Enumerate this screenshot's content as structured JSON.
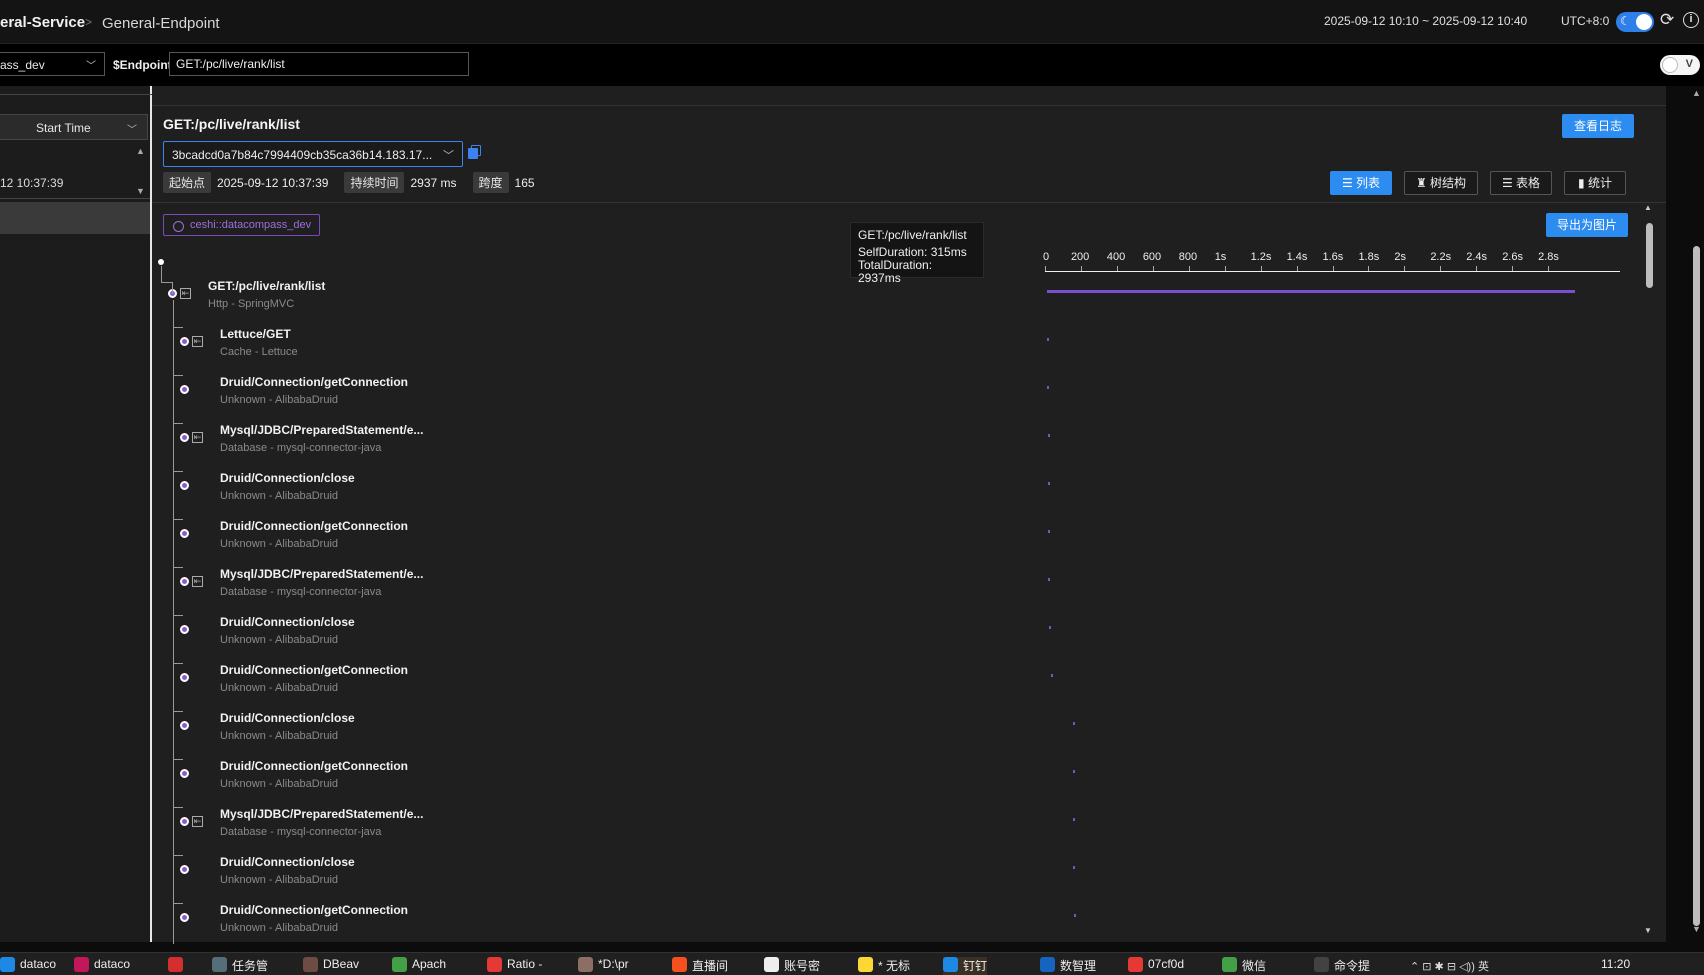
{
  "header": {
    "service": "eral-Service",
    "separator": ">",
    "endpoint": "General-Endpoint",
    "time_range": "2025-09-12 10:10 ~ 2025-09-12 10:40",
    "timezone": "UTC+8:0"
  },
  "filters": {
    "service_value": "ass_dev",
    "endpoint_label": "$Endpoint",
    "endpoint_value": "GET:/pc/live/rank/list",
    "v_toggle_label": "V"
  },
  "left_panel": {
    "sort_label": "Start Time",
    "trace_time": "12 10:37:39"
  },
  "trace": {
    "title": "GET:/pc/live/rank/list",
    "view_log": "查看日志",
    "trace_id": "3bcadcd0a7b84c7994409cb35ca36b14.183.17...",
    "start_label": "起始点",
    "start_value": "2025-09-12 10:37:39",
    "duration_label": "持续时间",
    "duration_value": "2937 ms",
    "span_label": "跨度",
    "span_value": "165",
    "tabs": [
      "列表",
      "树结构",
      "表格",
      "统计"
    ],
    "service_chip": "ceshi::datacompass_dev",
    "export": "导出为图片"
  },
  "tooltip": {
    "name": "GET:/pc/live/rank/list",
    "self": "SelfDuration: 315ms",
    "total": "TotalDuration: 2937ms"
  },
  "axis_ticks": [
    "0",
    "200",
    "400",
    "600",
    "800",
    "1s",
    "1.2s",
    "1.4s",
    "1.6s",
    "1.8s",
    "2s",
    "2.2s",
    "2.4s",
    "2.6s",
    "2.8s"
  ],
  "spans": [
    {
      "name": "GET:/pc/live/rank/list",
      "sub": "Http - SpringMVC",
      "level": 0,
      "toggle": true
    },
    {
      "name": "Lettuce/GET",
      "sub": "Cache - Lettuce",
      "level": 1,
      "toggle": true
    },
    {
      "name": "Druid/Connection/getConnection",
      "sub": "Unknown - AlibabaDruid",
      "level": 1,
      "toggle": false
    },
    {
      "name": "Mysql/JDBC/PreparedStatement/e...",
      "sub": "Database - mysql-connector-java",
      "level": 1,
      "toggle": true
    },
    {
      "name": "Druid/Connection/close",
      "sub": "Unknown - AlibabaDruid",
      "level": 1,
      "toggle": false
    },
    {
      "name": "Druid/Connection/getConnection",
      "sub": "Unknown - AlibabaDruid",
      "level": 1,
      "toggle": false
    },
    {
      "name": "Mysql/JDBC/PreparedStatement/e...",
      "sub": "Database - mysql-connector-java",
      "level": 1,
      "toggle": true
    },
    {
      "name": "Druid/Connection/close",
      "sub": "Unknown - AlibabaDruid",
      "level": 1,
      "toggle": false
    },
    {
      "name": "Druid/Connection/getConnection",
      "sub": "Unknown - AlibabaDruid",
      "level": 1,
      "toggle": false
    },
    {
      "name": "Druid/Connection/close",
      "sub": "Unknown - AlibabaDruid",
      "level": 1,
      "toggle": false
    },
    {
      "name": "Druid/Connection/getConnection",
      "sub": "Unknown - AlibabaDruid",
      "level": 1,
      "toggle": false
    },
    {
      "name": "Mysql/JDBC/PreparedStatement/e...",
      "sub": "Database - mysql-connector-java",
      "level": 1,
      "toggle": true
    },
    {
      "name": "Druid/Connection/close",
      "sub": "Unknown - AlibabaDruid",
      "level": 1,
      "toggle": false
    },
    {
      "name": "Druid/Connection/getConnection",
      "sub": "Unknown - AlibabaDruid",
      "level": 1,
      "toggle": false
    }
  ],
  "span_timing_ms": [
    {
      "start": 0,
      "end": 2937
    },
    {
      "start": 0,
      "end": 8
    },
    {
      "start": 2,
      "end": 9
    },
    {
      "start": 3,
      "end": 10
    },
    {
      "start": 4,
      "end": 11
    },
    {
      "start": 6,
      "end": 13
    },
    {
      "start": 8,
      "end": 15
    },
    {
      "start": 10,
      "end": 17
    },
    {
      "start": 22,
      "end": 35
    },
    {
      "start": 142,
      "end": 149
    },
    {
      "start": 143,
      "end": 150
    },
    {
      "start": 145,
      "end": 152
    },
    {
      "start": 147,
      "end": 154
    },
    {
      "start": 149,
      "end": 156
    }
  ],
  "taskbar": {
    "items": [
      {
        "label": "dataco",
        "color": "#1e88e5"
      },
      {
        "label": "dataco",
        "color": "#c2185b"
      },
      {
        "label": "",
        "color": "#d32f2f"
      },
      {
        "label": "任务管",
        "color": "#546e7a"
      },
      {
        "label": "DBeav",
        "color": "#6d4c41"
      },
      {
        "label": "Apach",
        "color": "#43a047"
      },
      {
        "label": "Ratio -",
        "color": "#e53935"
      },
      {
        "label": "*D:\\pr",
        "color": "#8d6e63"
      },
      {
        "label": "直播间",
        "color": "#f4511e"
      },
      {
        "label": "账号密",
        "color": "#eeeeee"
      },
      {
        "label": "* 无标",
        "color": "#fdd835"
      },
      {
        "label": "钉钉",
        "color": "#1e88e5"
      },
      {
        "label": "数智理",
        "color": "#1565c0"
      },
      {
        "label": "07cf0d",
        "color": "#e53935"
      },
      {
        "label": "微信",
        "color": "#43a047"
      },
      {
        "label": "命令提",
        "color": "#424242"
      }
    ],
    "tray_text": "英",
    "clock": "11:20"
  }
}
